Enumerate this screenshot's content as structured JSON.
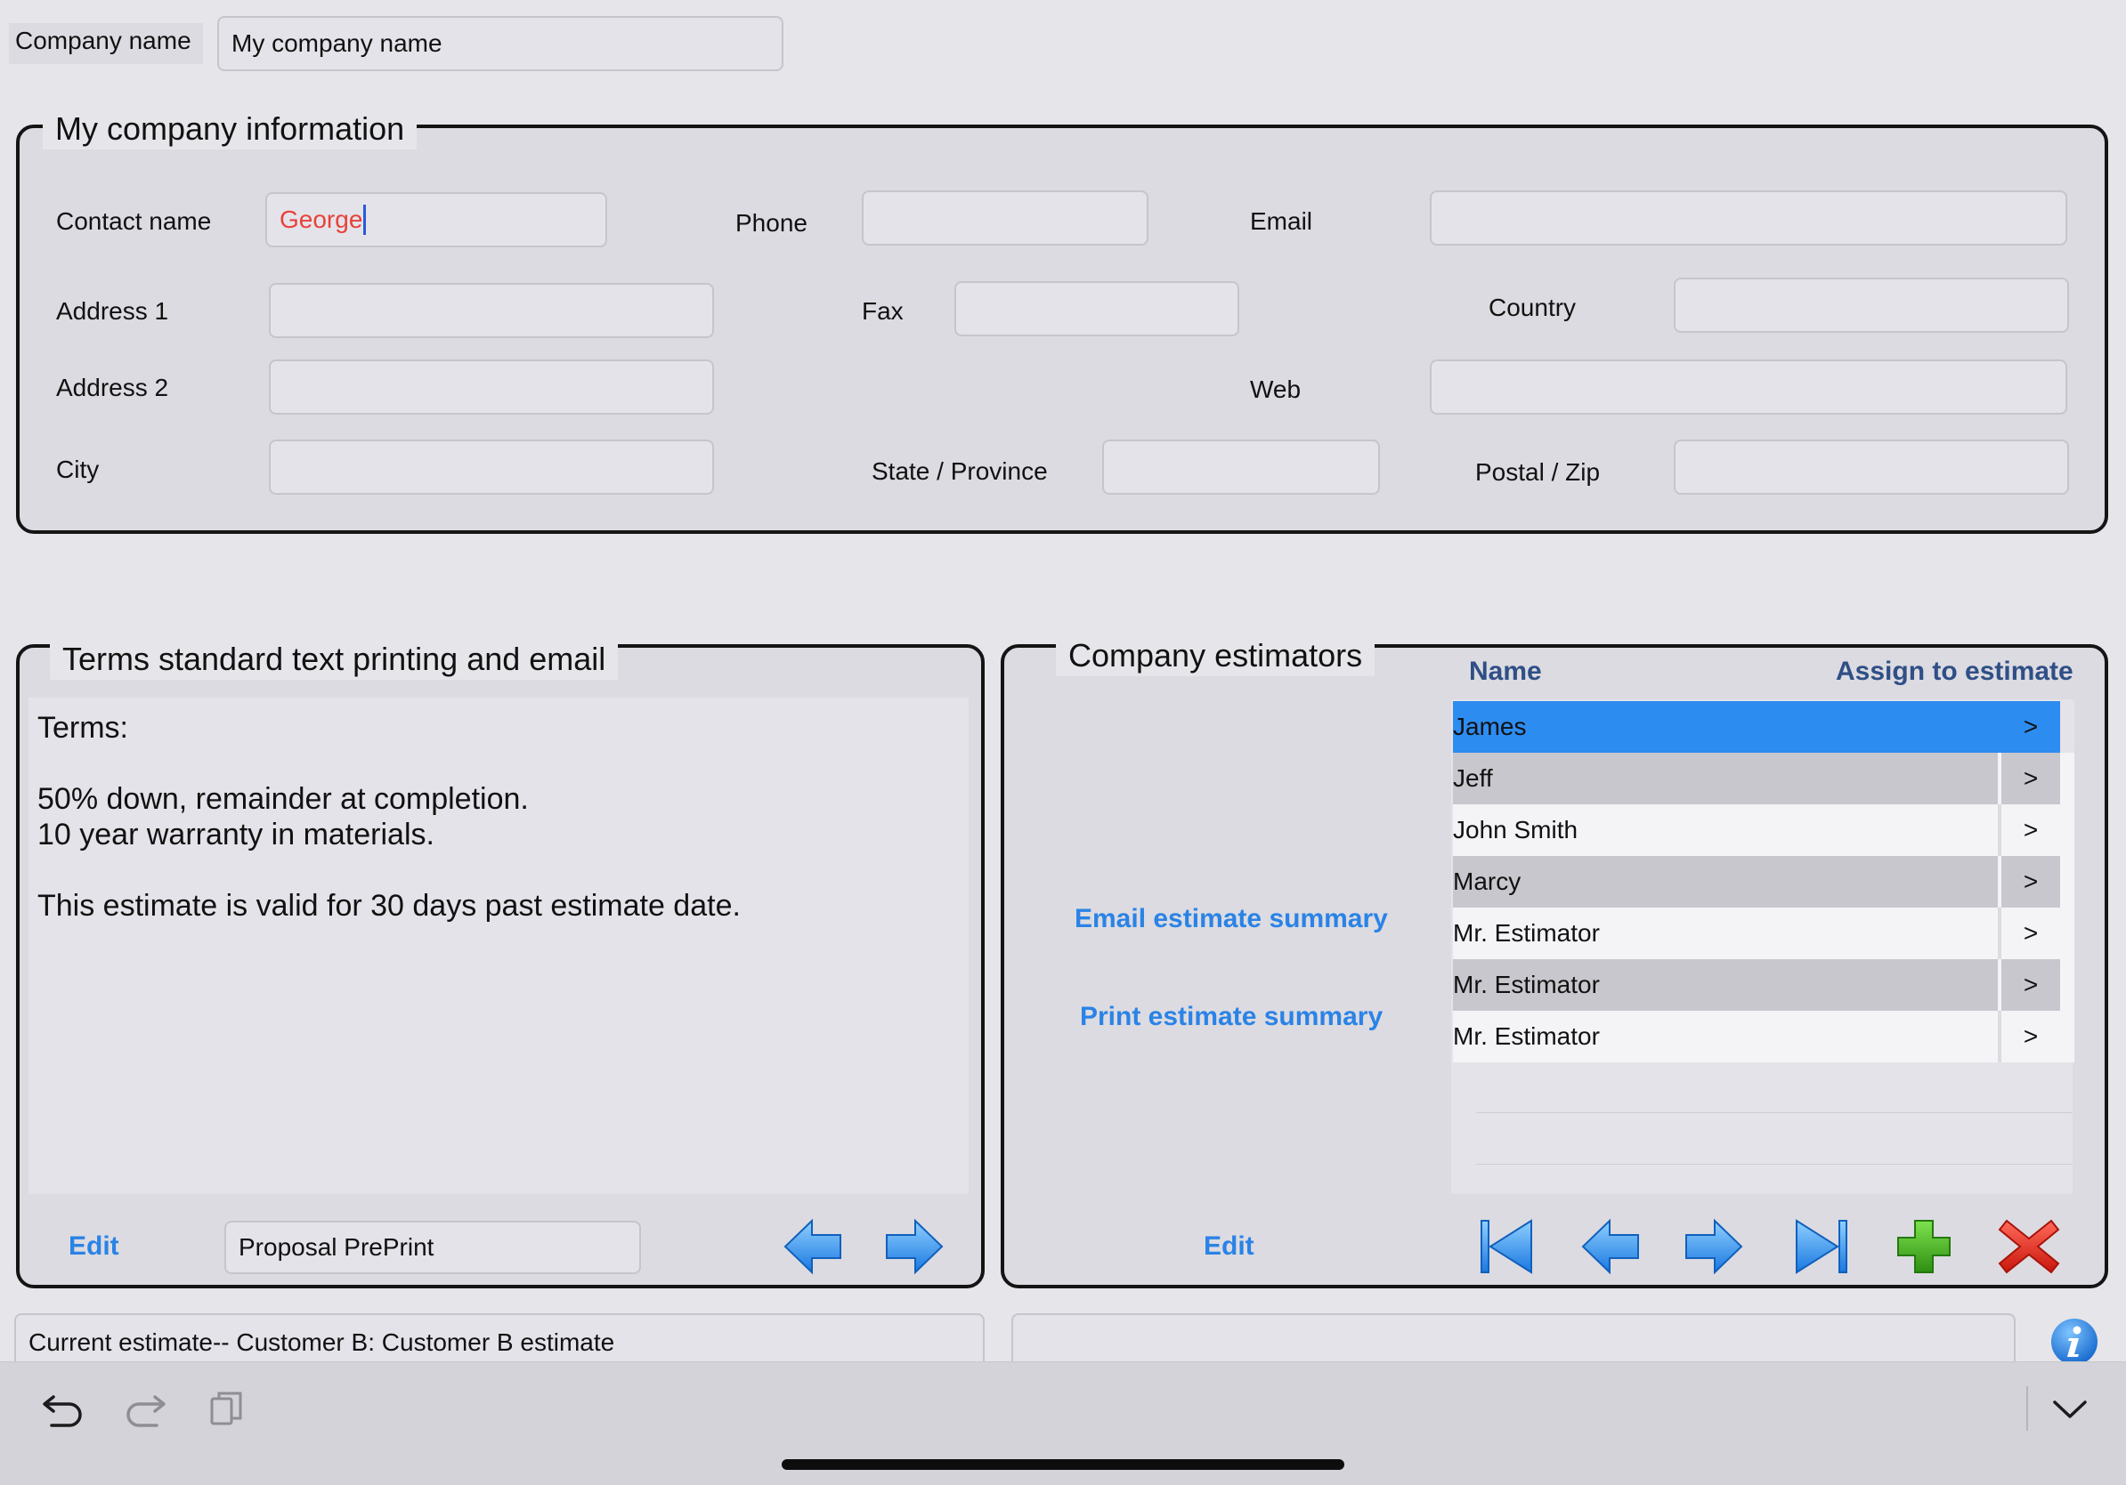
{
  "company": {
    "label": "Company name",
    "value": "My company name"
  },
  "info": {
    "legend": "My company information",
    "contact_label": "Contact name",
    "contact_value": "George",
    "phone_label": "Phone",
    "email_label": "Email",
    "address1_label": "Address 1",
    "fax_label": "Fax",
    "country_label": "Country",
    "address2_label": "Address 2",
    "web_label": "Web",
    "city_label": "City",
    "state_label": "State / Province",
    "postal_label": "Postal / Zip"
  },
  "terms": {
    "legend": "Terms standard text printing and email",
    "lines": [
      "Terms:",
      "",
      "50% down, remainder at completion.",
      "10 year warranty in materials.",
      "",
      "This estimate is valid for 30 days past estimate date."
    ],
    "edit_label": "Edit",
    "template_value": "Proposal PrePrint"
  },
  "estimators": {
    "legend": "Company estimators",
    "col_name": "Name",
    "col_assign": "Assign to estimate",
    "email_link": "Email estimate summary",
    "print_link": "Print estimate summary",
    "edit_label": "Edit",
    "assign_glyph": ">",
    "rows": [
      {
        "name": "James"
      },
      {
        "name": "Jeff"
      },
      {
        "name": "John Smith"
      },
      {
        "name": "Marcy"
      },
      {
        "name": "Mr. Estimator"
      },
      {
        "name": "Mr. Estimator"
      },
      {
        "name": "Mr. Estimator"
      }
    ]
  },
  "status": {
    "current_estimate": "Current estimate--  Customer B: Customer B estimate"
  },
  "colors": {
    "accent": "#2a83e6",
    "selected_row": "#2d8cf0",
    "contact_text": "#e8423a",
    "add_green": "#3aa51c",
    "delete_red": "#e0231a"
  }
}
